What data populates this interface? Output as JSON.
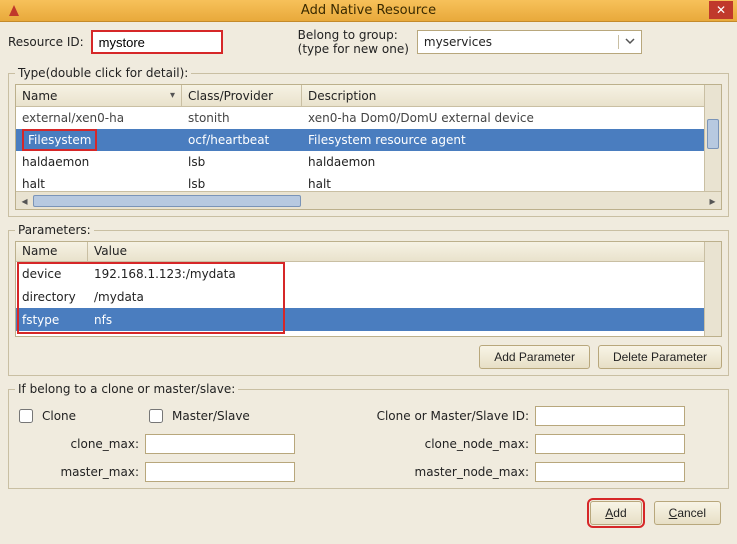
{
  "title": "Add Native Resource",
  "fields": {
    "resource_id_label": "Resource ID:",
    "resource_id_value": "mystore",
    "belong_label_1": "Belong to group:",
    "belong_label_2": "(type for new one)",
    "belong_value": "myservices"
  },
  "type_section": {
    "legend": "Type(double click for detail):",
    "columns": {
      "name": "Name",
      "class": "Class/Provider",
      "desc": "Description"
    },
    "rows": [
      {
        "name": "external/xen0-ha",
        "class": "stonith",
        "desc": "xen0-ha Dom0/DomU external device",
        "faded": true
      },
      {
        "name": "Filesystem",
        "class": "ocf/heartbeat",
        "desc": "Filesystem resource agent",
        "selected": true,
        "hl": true
      },
      {
        "name": "haldaemon",
        "class": "lsb",
        "desc": "haldaemon"
      },
      {
        "name": "halt",
        "class": "lsb",
        "desc": "halt"
      }
    ]
  },
  "param_section": {
    "legend": "Parameters:",
    "columns": {
      "name": "Name",
      "value": "Value"
    },
    "rows": [
      {
        "name": "device",
        "value": "192.168.1.123:/mydata"
      },
      {
        "name": "directory",
        "value": "/mydata"
      },
      {
        "name": "fstype",
        "value": "nfs",
        "selected": true
      }
    ],
    "add_btn": "Add Parameter",
    "del_btn": "Delete Parameter"
  },
  "clone_section": {
    "legend": "If belong to a clone or master/slave:",
    "clone_chk": "Clone",
    "ms_chk": "Master/Slave",
    "clone_ms_id_label": "Clone or Master/Slave ID:",
    "clone_max": "clone_max:",
    "clone_node_max": "clone_node_max:",
    "master_max": "master_max:",
    "master_node_max": "master_node_max:"
  },
  "buttons": {
    "add": "Add",
    "add_u": "A",
    "add_rest": "dd",
    "cancel": "Cancel",
    "cancel_u": "C",
    "cancel_rest": "ancel"
  }
}
